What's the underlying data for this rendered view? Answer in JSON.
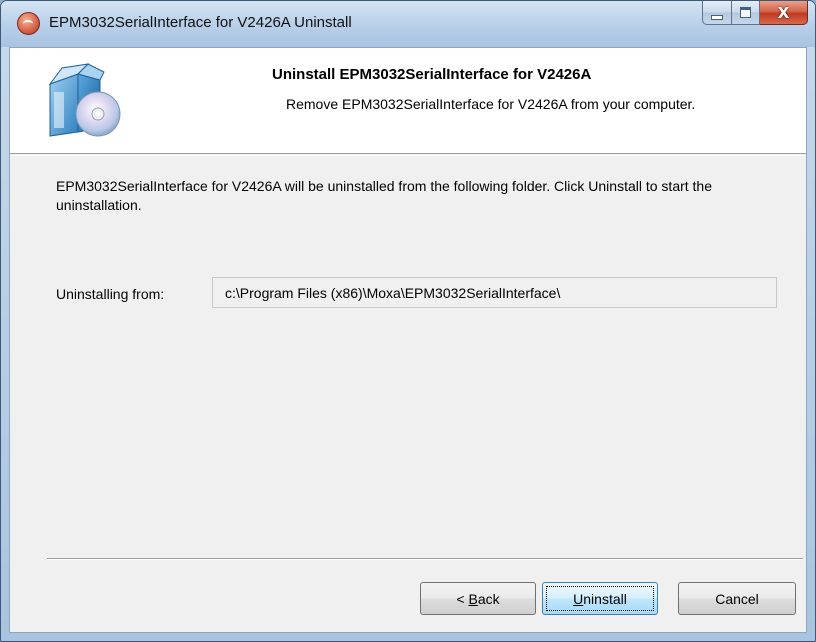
{
  "window": {
    "title": "EPM3032SerialInterface for V2426A Uninstall",
    "caption_buttons": {
      "minimize_icon": "minimize-icon",
      "maximize_icon": "maximize-icon",
      "close_glyph": "X"
    }
  },
  "banner": {
    "title": "Uninstall EPM3032SerialInterface for V2426A",
    "subtitle": "Remove EPM3032SerialInterface for V2426A from your computer.",
    "icon": "installer-box-cd-icon"
  },
  "body": {
    "description": "EPM3032SerialInterface for V2426A will be uninstalled from the following folder. Click Uninstall to start the uninstallation.",
    "uninstall_from_label": "Uninstalling from:",
    "uninstall_path": "c:\\Program Files (x86)\\Moxa\\EPM3032SerialInterface\\"
  },
  "buttons": {
    "back": {
      "pre": "< ",
      "key": "B",
      "rest": "ack"
    },
    "uninstall": {
      "key": "U",
      "rest": "ninstall"
    },
    "cancel": "Cancel"
  },
  "colors": {
    "title_bar": "#bcd2ea",
    "close_button": "#c1391f",
    "dialog_background": "#f0f0f0",
    "default_button_border": "#3c7fb1"
  }
}
